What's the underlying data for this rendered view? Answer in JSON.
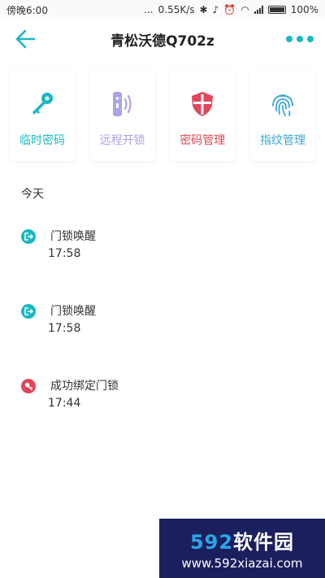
{
  "status_bar": {
    "time": "傍晚6:00",
    "dots": "...",
    "speed": "0.55K/s",
    "battery": "100%"
  },
  "header": {
    "title": "青松沃德Q702z"
  },
  "tiles": [
    {
      "label": "临时密码",
      "icon": "key-icon",
      "color": "#1ab8c4"
    },
    {
      "label": "远程开锁",
      "icon": "remote-icon",
      "color": "#a9a5e3"
    },
    {
      "label": "密码管理",
      "icon": "shield-icon",
      "color": "#e0475a"
    },
    {
      "label": "指纹管理",
      "icon": "fingerprint-icon",
      "color": "#3aa7d6"
    }
  ],
  "records_section": {
    "title": "今天"
  },
  "records": [
    {
      "text": "门锁唤醒",
      "time": "17:58",
      "icon": "exit-door-icon",
      "color": "#1ab8c4"
    },
    {
      "text": "门锁唤醒",
      "time": "17:58",
      "icon": "exit-door-icon",
      "color": "#1ab8c4"
    },
    {
      "text": "成功绑定门锁",
      "time": "17:44",
      "icon": "key-icon",
      "color": "#e0475a"
    }
  ],
  "watermark": {
    "brand_num": "592",
    "brand_text": "软件园",
    "url": "www.592xiazai.com"
  }
}
